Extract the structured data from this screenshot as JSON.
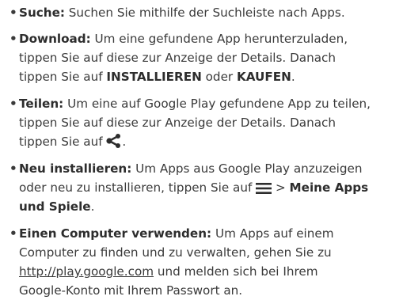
{
  "bullet": "•",
  "items": [
    {
      "label": "Suche:",
      "text": " Suchen Sie mithilfe der Suchleiste nach Apps."
    },
    {
      "label": "Download:",
      "text1": " Um eine gefundene App herunterzuladen,",
      "text2": "tippen Sie auf diese zur Anzeige der Details. Danach",
      "text3": "tippen Sie auf ",
      "bold1": "INSTALLIEREN",
      "mid": " oder ",
      "bold2": "KAUFEN",
      "end": "."
    },
    {
      "label": "Teilen:",
      "text1": " Um eine auf Google Play gefundene App zu teilen,",
      "text2": "tippen Sie auf diese zur Anzeige der Details. Danach",
      "text3": "tippen Sie auf ",
      "icon": "share-icon",
      "end": "."
    },
    {
      "label": "Neu installieren:",
      "text1": " Um Apps aus Google Play anzuzeigen",
      "text2": "oder neu zu installieren, tippen Sie auf ",
      "icon": "menu-icon",
      "sep": " > ",
      "bold1": "Meine Apps",
      "bold2": "und Spiele",
      "end": "."
    },
    {
      "label": "Einen Computer verwenden:",
      "text1": " Um Apps auf einem",
      "text2": "Computer zu finden und zu verwalten, gehen Sie zu",
      "link": "http://play.google.com",
      "text3": " und melden sich bei Ihrem",
      "text4": "Google-Konto mit Ihrem Passwort an."
    }
  ]
}
